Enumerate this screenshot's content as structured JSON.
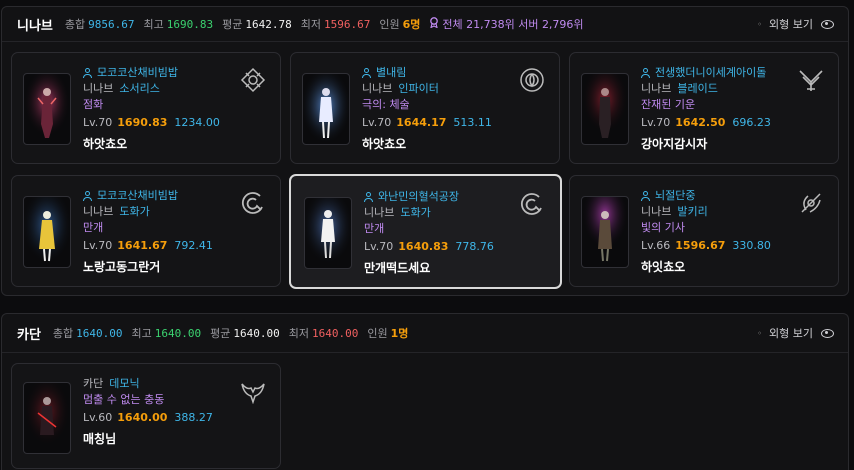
{
  "groups": [
    {
      "server": "니나브",
      "stats": {
        "total_label": "총합",
        "total": "9856.67",
        "max_label": "최고",
        "max": "1690.83",
        "avg_label": "평균",
        "avg": "1642.78",
        "min_label": "최저",
        "min": "1596.67",
        "count_label": "인원",
        "count": "6명"
      },
      "rank": {
        "icon": "ribbon-icon",
        "text": "전체 21,738위 서버 2,796위"
      },
      "view_label": "외형 보기",
      "characters": [
        {
          "name": "모코코산채비빔밥",
          "server": "니나브",
          "class": "소서리스",
          "title": "점화",
          "level": "Lv.70",
          "item_level": "1690.83",
          "combat": "1234.00",
          "guild": "하앗쵸오",
          "emblem": "sorceress-class-icon"
        },
        {
          "name": "별내림",
          "server": "니나브",
          "class": "인파이터",
          "title": "극의: 체술",
          "level": "Lv.70",
          "item_level": "1644.17",
          "combat": "513.11",
          "guild": "하앗쵸오",
          "emblem": "infighter-class-icon"
        },
        {
          "name": "전생했더니이세계아이돌",
          "server": "니나브",
          "class": "블레이드",
          "title": "잔재된 기운",
          "level": "Lv.70",
          "item_level": "1642.50",
          "combat": "696.23",
          "guild": "강아지감시자",
          "emblem": "blade-class-icon"
        },
        {
          "name": "모코코산채비빔밥",
          "server": "니나브",
          "class": "도화가",
          "title": "만개",
          "level": "Lv.70",
          "item_level": "1641.67",
          "combat": "792.41",
          "guild": "노랑고동그란거",
          "emblem": "artist-class-icon"
        },
        {
          "name": "와난민의혈석공장",
          "server": "니나브",
          "class": "도화가",
          "title": "만개",
          "level": "Lv.70",
          "item_level": "1640.83",
          "combat": "778.76",
          "guild": "만개떡드세요",
          "emblem": "artist-class-icon"
        },
        {
          "name": "뇌절단중",
          "server": "니나브",
          "class": "발키리",
          "title": "빛의 기사",
          "level": "Lv.66",
          "item_level": "1596.67",
          "combat": "330.80",
          "guild": "하잇쵸오",
          "emblem": "valkyrie-class-icon"
        }
      ]
    },
    {
      "server": "카단",
      "stats": {
        "total_label": "총합",
        "total": "1640.00",
        "max_label": "최고",
        "max": "1640.00",
        "avg_label": "평균",
        "avg": "1640.00",
        "min_label": "최저",
        "min": "1640.00",
        "count_label": "인원",
        "count": "1명"
      },
      "view_label": "외형 보기",
      "characters": [
        {
          "server": "카단",
          "class": "데모닉",
          "title": "멈출 수 없는 충동",
          "level": "Lv.60",
          "item_level": "1640.00",
          "combat": "388.27",
          "guild": "매칭님",
          "emblem": "demonic-class-icon"
        }
      ]
    }
  ],
  "colors": {
    "accent_blue": "#3fb6e8",
    "item_level": "#f59e0b",
    "title": "#c08bf0",
    "max": "#3bd16f",
    "min": "#f06060"
  }
}
